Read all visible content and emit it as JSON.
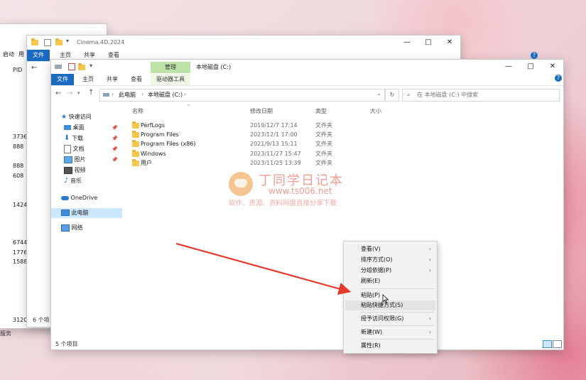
{
  "back_window": {
    "menu_items": [
      "启动",
      "用"
    ],
    "column_header": "PID",
    "pids": [
      "3736",
      "888",
      "888",
      "608",
      "1424",
      "6744",
      "1776",
      "1588",
      "3120"
    ],
    "footer": "服务"
  },
  "mid_window": {
    "title": "Cinema.4D.2024",
    "tabs": [
      "文件",
      "主页",
      "共享",
      "查看"
    ],
    "status": "6 个项"
  },
  "front_window": {
    "context_tab": "管理",
    "title": "本地磁盘 (C:)",
    "tabs": [
      "文件",
      "主页",
      "共享",
      "查看",
      "驱动器工具"
    ],
    "breadcrumb": [
      "此电脑",
      "本地磁盘 (C:)"
    ],
    "search_placeholder": "在 本地磁盘 (C:) 中搜索",
    "nav": {
      "quick_access": "快速访问",
      "items": [
        "桌面",
        "下载",
        "文档",
        "图片",
        "视频",
        "音乐"
      ],
      "onedrive": "OneDrive",
      "this_pc": "此电脑",
      "network": "网络"
    },
    "columns": [
      "名称",
      "修改日期",
      "类型",
      "大小"
    ],
    "files": [
      {
        "name": "PerfLogs",
        "date": "2019/12/7 17:14",
        "type": "文件夹"
      },
      {
        "name": "Program Files",
        "date": "2023/12/1 17:00",
        "type": "文件夹"
      },
      {
        "name": "Program Files (x86)",
        "date": "2021/9/13 15:11",
        "type": "文件夹"
      },
      {
        "name": "Windows",
        "date": "2023/11/27 15:47",
        "type": "文件夹"
      },
      {
        "name": "用户",
        "date": "2023/11/25 13:39",
        "type": "文件夹"
      }
    ],
    "status": "5 个项目"
  },
  "context_menu": {
    "items": [
      {
        "label": "查看(V)",
        "submenu": true
      },
      {
        "label": "排序方式(O)",
        "submenu": true
      },
      {
        "label": "分组依据(P)",
        "submenu": true
      },
      {
        "label": "刷新(E)",
        "submenu": false
      },
      {
        "label": "粘贴(P)",
        "submenu": false
      },
      {
        "label": "粘贴快捷方式(S)",
        "submenu": false
      },
      {
        "label": "授予访问权限(G)",
        "submenu": true
      },
      {
        "label": "新建(W)",
        "submenu": true
      },
      {
        "label": "属性(R)",
        "submenu": false
      }
    ]
  },
  "watermark": {
    "title": "丁同学日记本",
    "url": "www.ts006.net",
    "subtitle": "软件、资源、资料网盘直接分享下载"
  },
  "colors": {
    "file_tab": "#1a6ac0",
    "context_tab": "#bde3a7",
    "selection": "#cce8ff",
    "arrow": "#e8372b",
    "folder": "#f5c84c"
  }
}
